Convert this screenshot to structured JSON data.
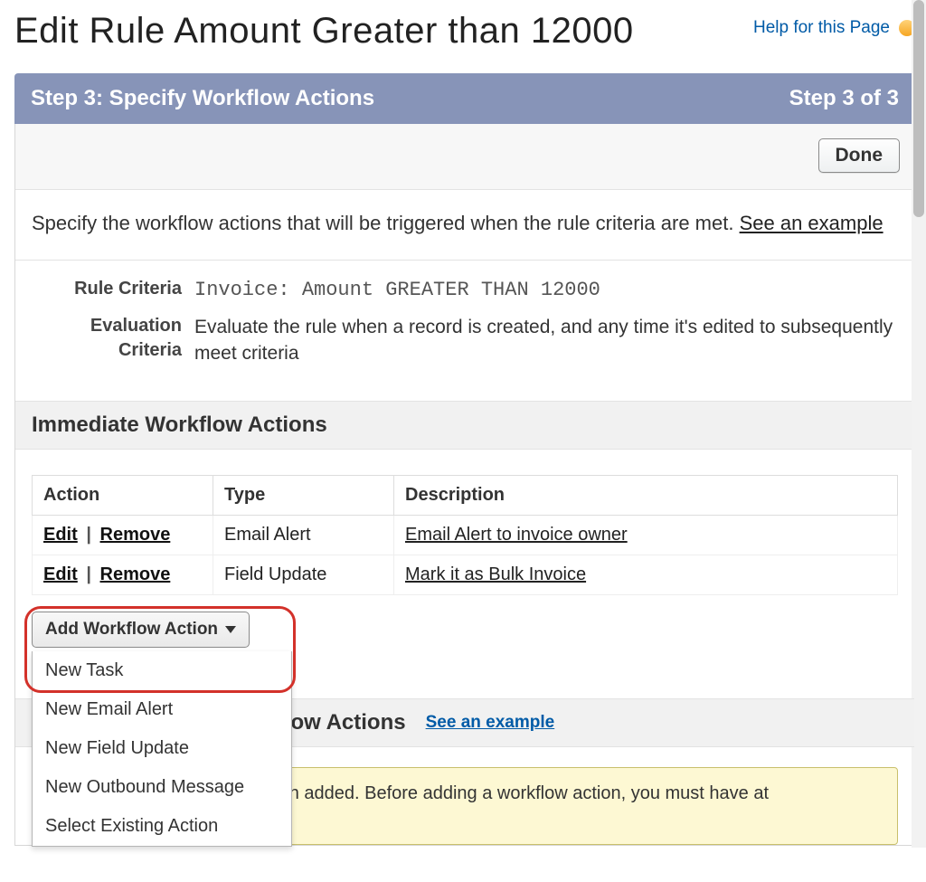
{
  "page_title": "Edit Rule Amount Greater than 12000",
  "help_link": "Help for this Page",
  "step_bar": {
    "left": "Step 3: Specify Workflow Actions",
    "right": "Step 3 of 3"
  },
  "done_label": "Done",
  "instruction": {
    "text": "Specify the workflow actions that will be triggered when the rule criteria are met. ",
    "link": "See an example"
  },
  "criteria": {
    "rule_label": "Rule Criteria",
    "rule_value": "Invoice: Amount GREATER THAN 12000",
    "eval_label": "Evaluation Criteria",
    "eval_value": "Evaluate the rule when a record is created, and any time it's edited to subsequently meet criteria"
  },
  "immediate_section_title": "Immediate Workflow Actions",
  "table": {
    "headers": {
      "action": "Action",
      "type": "Type",
      "description": "Description"
    },
    "edit": "Edit",
    "remove": "Remove",
    "rows": [
      {
        "type": "Email Alert",
        "description": "Email Alert to invoice owner"
      },
      {
        "type": "Field Update",
        "description": "Mark it as Bulk Invoice"
      }
    ]
  },
  "add_button_label": "Add Workflow Action",
  "dropdown_items": [
    "New Task",
    "New Email Alert",
    "New Field Update",
    "New Outbound Message",
    "Select Existing Action"
  ],
  "time_dependent_section_title": "Time-Dependent Workflow Actions",
  "see_example": "See an example",
  "notice": "No workflow actions have been added. Before adding a workflow action, you must have at least one time trigger defined."
}
